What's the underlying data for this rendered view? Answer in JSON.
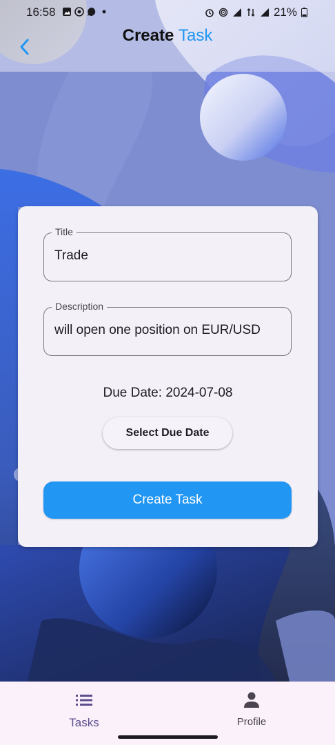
{
  "status_bar": {
    "time": "16:58",
    "battery": "21%",
    "left_icons": [
      "gallery-icon",
      "whatsapp-icon",
      "chat-icon",
      "dot-icon"
    ],
    "right_icons": [
      "alarm-icon",
      "hotspot-icon",
      "signal-icon",
      "data-icon",
      "signal-icon",
      "battery-icon"
    ]
  },
  "app_bar": {
    "title_part1": "Create",
    "title_part2": "Task",
    "back_icon": "chevron-left-icon",
    "accent_color": "#2196f3"
  },
  "form": {
    "title_label": "Title",
    "title_value": "Trade",
    "description_label": "Description",
    "description_value": "will open one position on EUR/USD",
    "due_date_label": "Due Date:",
    "due_date_value": "2024-07-08",
    "select_date_button": "Select Due Date",
    "create_button": "Create Task"
  },
  "bottom_nav": {
    "items": [
      {
        "label": "Tasks",
        "icon": "list-icon"
      },
      {
        "label": "Profile",
        "icon": "person-icon"
      }
    ]
  }
}
